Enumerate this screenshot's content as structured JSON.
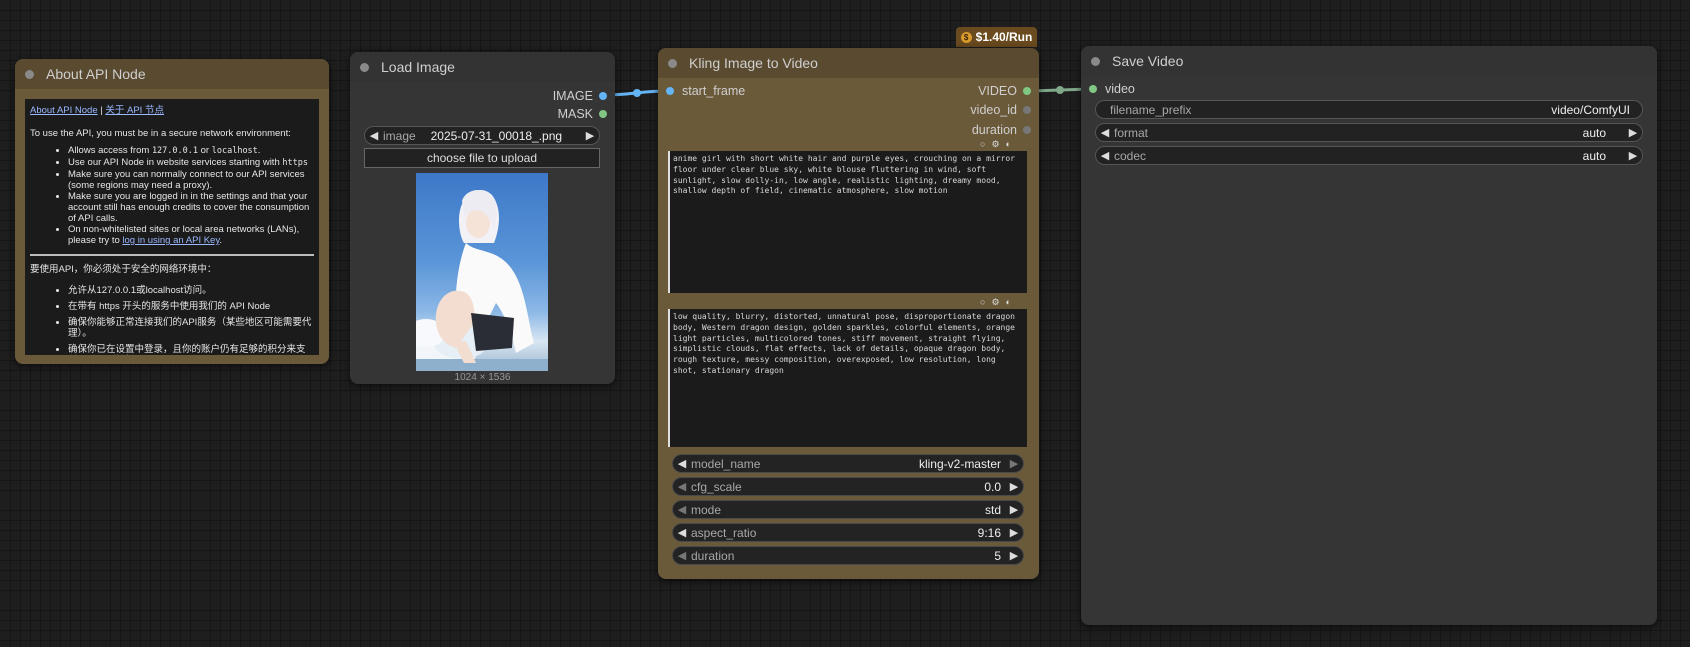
{
  "colors": {
    "brown_node": "#6b5a3a",
    "gray_node": "#353535",
    "image_socket": "#64b5f6",
    "mask_socket": "#81c784",
    "video_socket": "#81c784",
    "price_badge": "#6a4a1f"
  },
  "about_node": {
    "title": "About API Node",
    "link_en": "About API Node",
    "sep": " | ",
    "link_cn": "关于 API 节点",
    "intro": "To use the API, you must be in a secure network environment:",
    "bullet1_pre": "Allows access from ",
    "bullet1_code1": "127.0.0.1",
    "bullet1_mid": " or ",
    "bullet1_code2": "localhost",
    "bullet1_post": ".",
    "bullet2_pre": "Use our API Node in website services starting with ",
    "bullet2_code": "https",
    "bullet3": "Make sure you can normally connect to our API services (some regions may need a proxy).",
    "bullet4": "Make sure you are logged in in the settings and that your account still has enough credits to cover the consumption of API calls.",
    "bullet5_pre": "On non-whitelisted sites or local area networks (LANs), please try to ",
    "bullet5_link": "log in using an API Key",
    "bullet5_post": ".",
    "cn_intro": "要使用API，你必须处于安全的网络环境中：",
    "cn_bullet1": "允许从127.0.0.1或localhost访问。",
    "cn_bullet2": "在带有 https 开头的服务中使用我们的 API Node",
    "cn_bullet3": "确保你能够正常连接我们的API服务（某些地区可能需要代理）。",
    "cn_bullet4": "确保你已在设置中登录，且你的账户仍有足够的积分来支付API调用的消耗。"
  },
  "load_image_node": {
    "title": "Load Image",
    "output_image": "IMAGE",
    "output_mask": "MASK",
    "image_widget_label": "image",
    "image_widget_value": "2025-07-31_00018_.png",
    "upload_button": "choose file to upload",
    "dimensions": "1024 × 1536"
  },
  "kling_node": {
    "title": "Kling Image to Video",
    "price": "$1.40/Run",
    "coin_symbol": "$",
    "input_start_frame": "start_frame",
    "output_video": "VIDEO",
    "output_video_id": "video_id",
    "output_duration": "duration",
    "positive_prompt": "anime girl with short white hair and purple eyes, crouching on a mirror floor under clear blue sky, white blouse fluttering in wind, soft sunlight, slow dolly-in, low angle, realistic lighting, dreamy mood, shallow depth of field, cinematic atmosphere, slow motion",
    "negative_prompt": "low quality, blurry, distorted, unnatural pose, disproportionate dragon body, Western dragon design, golden sparkles, colorful elements, orange light particles, multicolored tones, stiff movement, straight flying, simplistic clouds, flat effects, lack of details, opaque dragon body, rough texture, messy composition, overexposed, low resolution, long shot, stationary dragon",
    "widgets": [
      {
        "label": "model_name",
        "value": "kling-v2-master"
      },
      {
        "label": "cfg_scale",
        "value": "0.0"
      },
      {
        "label": "mode",
        "value": "std"
      },
      {
        "label": "aspect_ratio",
        "value": "9:16"
      },
      {
        "label": "duration",
        "value": "5"
      }
    ]
  },
  "save_video_node": {
    "title": "Save Video",
    "input_video": "video",
    "widgets": [
      {
        "label": "filename_prefix",
        "value": "video/ComfyUI"
      },
      {
        "label": "format",
        "value": "auto"
      },
      {
        "label": "codec",
        "value": "auto"
      }
    ]
  }
}
